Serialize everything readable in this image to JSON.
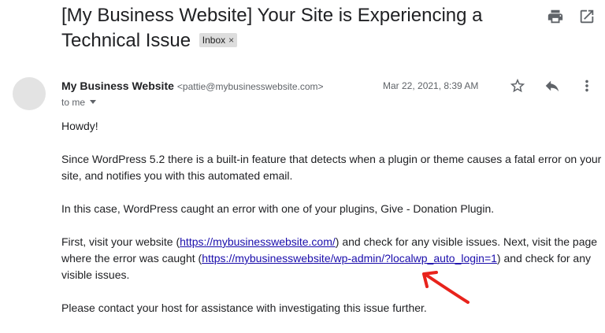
{
  "email": {
    "subject": "[My Business Website] Your Site is Experiencing a Technical Issue",
    "label": "Inbox",
    "label_remove": "×",
    "sender_name": "My Business Website",
    "sender_email": "<pattie@mybusinesswebsite.com>",
    "date": "Mar 22, 2021, 8:39 AM",
    "to": "to me"
  },
  "body": {
    "greeting": "Howdy!",
    "p1": "Since WordPress 5.2 there is a built-in feature that detects when a plugin or theme causes a fatal error on your site, and notifies you with this automated email.",
    "p2": "In this case, WordPress caught an error with one of your plugins, Give - Donation Plugin.",
    "p3_a": "First, visit your website (",
    "p3_link1": "https://mybusinesswebsite.com/",
    "p3_b": ") and check for any visible issues. Next, visit the page where the error was caught (",
    "p3_link2": "https://mybusinesswebsite/wp-admin/?localwp_auto_login=1",
    "p3_c": ") and check for any visible issues.",
    "p4": "Please contact your host for assistance with investigating this issue further."
  },
  "icons": {
    "print": "print-icon",
    "open_new_window": "open-in-new-window-icon",
    "star": "star-icon",
    "reply": "reply-icon",
    "more": "more-vert-icon",
    "arrow": "red-arrow-annotation"
  },
  "colors": {
    "link": "#1a0dab",
    "annotation": "#e8231c",
    "badge_bg": "#dddddd",
    "muted": "#5f6368"
  }
}
